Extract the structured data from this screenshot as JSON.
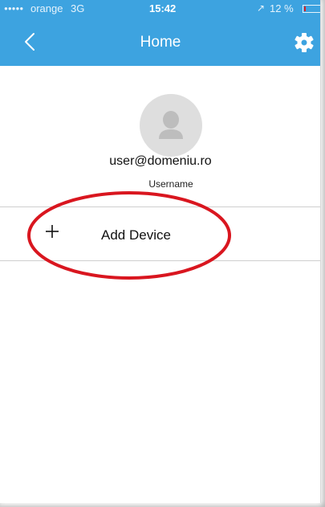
{
  "status_bar": {
    "signal": "●●●●●",
    "carrier": "orange",
    "network": "3G",
    "time": "15:42",
    "location_icon": "location-arrow-icon",
    "battery_percent": "12 %",
    "battery_level": 0.12,
    "battery_color": "#e02020"
  },
  "nav": {
    "title": "Home",
    "back_icon": "chevron-left-icon",
    "settings_icon": "gear-icon"
  },
  "profile": {
    "avatar_icon": "user-silhouette-icon",
    "email": "user@domeniu.ro",
    "username_label": "Username"
  },
  "actions": {
    "add_device_label": "Add Device",
    "add_device_icon": "plus-icon",
    "highlight_color": "#d9161f"
  },
  "theme": {
    "accent": "#3da3e0"
  }
}
